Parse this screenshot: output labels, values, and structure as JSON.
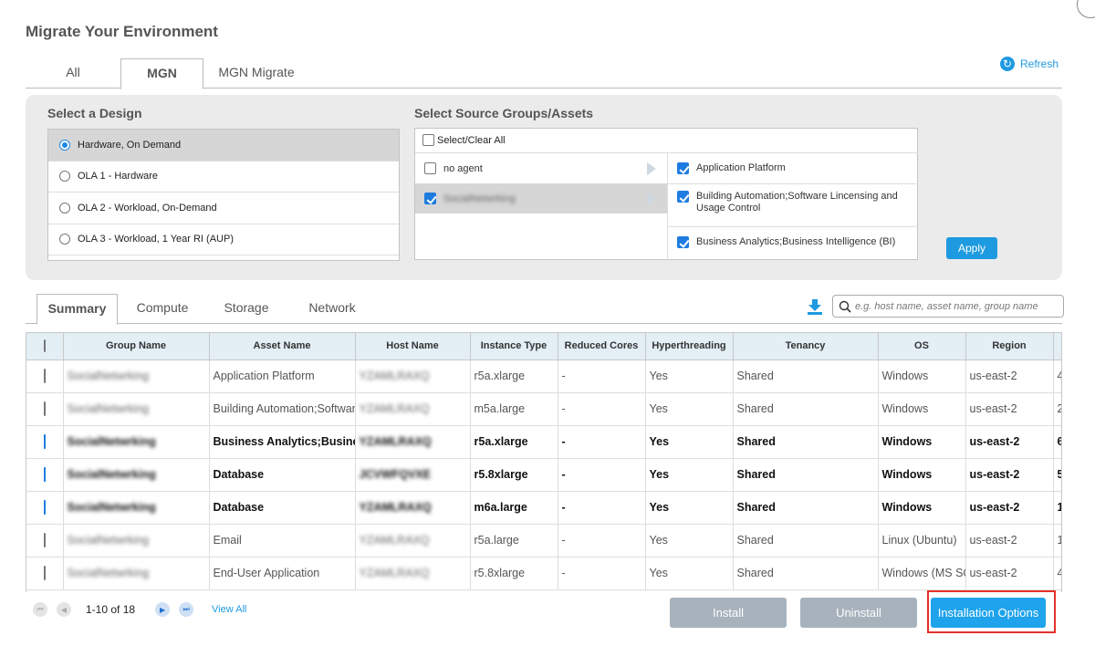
{
  "dialog": {
    "title": "Migrate Your Environment"
  },
  "top_tabs": [
    "All",
    "MGN",
    "MGN Migrate"
  ],
  "refresh_label": "Refresh",
  "design": {
    "label": "Select a Design",
    "options": [
      "Hardware, On Demand",
      "OLA 1 - Hardware",
      "OLA 2 - Workload, On-Demand",
      "OLA 3 - Workload, 1 Year RI (AUP)"
    ],
    "selected_index": 0
  },
  "source": {
    "label": "Select Source Groups/Assets",
    "select_all": "Select/Clear All",
    "groups": [
      {
        "label": "no agent",
        "checked": false
      },
      {
        "label": "SocialNetwrking",
        "checked": true
      }
    ],
    "assets": [
      {
        "label": "Application Platform",
        "checked": true
      },
      {
        "label": "Building Automation;Software Lincensing and Usage Control",
        "checked": true
      },
      {
        "label": "Business Analytics;Business Intelligence (BI)",
        "checked": true
      }
    ],
    "apply_label": "Apply"
  },
  "sub_tabs": [
    "Summary",
    "Compute",
    "Storage",
    "Network"
  ],
  "search": {
    "placeholder": "e.g. host name, asset name, group name"
  },
  "table": {
    "columns": [
      "Group Name",
      "Asset Name",
      "Host Name",
      "Instance Type",
      "Reduced Cores",
      "Hyperthreading",
      "Tenancy",
      "OS",
      "Region",
      ""
    ],
    "rows": [
      {
        "checked": false,
        "group": "SocialNetwrking",
        "asset": "Application Platform",
        "host": "YZAMLRAXQ",
        "instance": "r5a.xlarge",
        "reduced": "-",
        "ht": "Yes",
        "tenancy": "Shared",
        "os": "Windows",
        "region": "us-east-2",
        "extra": "4"
      },
      {
        "checked": false,
        "group": "SocialNetwrking",
        "asset": "Building Automation;Software Lincensing",
        "host": "YZAMLRAXQ",
        "instance": "m5a.large",
        "reduced": "-",
        "ht": "Yes",
        "tenancy": "Shared",
        "os": "Windows",
        "region": "us-east-2",
        "extra": "2"
      },
      {
        "checked": true,
        "group": "SocialNetwrking",
        "asset": "Business Analytics;Business Intelligence",
        "host": "YZAMLRAXQ",
        "instance": "r5a.xlarge",
        "reduced": "-",
        "ht": "Yes",
        "tenancy": "Shared",
        "os": "Windows",
        "region": "us-east-2",
        "extra": "6"
      },
      {
        "checked": true,
        "group": "SocialNetwrking",
        "asset": "Database",
        "host": "JCVWFQVXE",
        "instance": "r5.8xlarge",
        "reduced": "-",
        "ht": "Yes",
        "tenancy": "Shared",
        "os": "Windows",
        "region": "us-east-2",
        "extra": "5"
      },
      {
        "checked": true,
        "group": "SocialNetwrking",
        "asset": "Database",
        "host": "YZAMLRAXQ",
        "instance": "m6a.large",
        "reduced": "-",
        "ht": "Yes",
        "tenancy": "Shared",
        "os": "Windows",
        "region": "us-east-2",
        "extra": "1"
      },
      {
        "checked": false,
        "group": "SocialNetwrking",
        "asset": "Email",
        "host": "YZAMLRAXQ",
        "instance": "r5a.large",
        "reduced": "-",
        "ht": "Yes",
        "tenancy": "Shared",
        "os": "Linux (Ubuntu)",
        "region": "us-east-2",
        "extra": "1"
      },
      {
        "checked": false,
        "group": "SocialNetwrking",
        "asset": "End-User Application",
        "host": "YZAMLRAXQ",
        "instance": "r5.8xlarge",
        "reduced": "-",
        "ht": "Yes",
        "tenancy": "Shared",
        "os": "Windows (MS SQL)",
        "region": "us-east-2",
        "extra": "4"
      }
    ]
  },
  "pager": {
    "info": "1-10 of 18",
    "view_all": "View All"
  },
  "buttons": {
    "install": "Install",
    "uninstall": "Uninstall",
    "options": "Installation Options"
  },
  "colors": {
    "accent": "#1e9ae0",
    "header_bg": "#e3eef5",
    "highlight": "#e5302a"
  }
}
